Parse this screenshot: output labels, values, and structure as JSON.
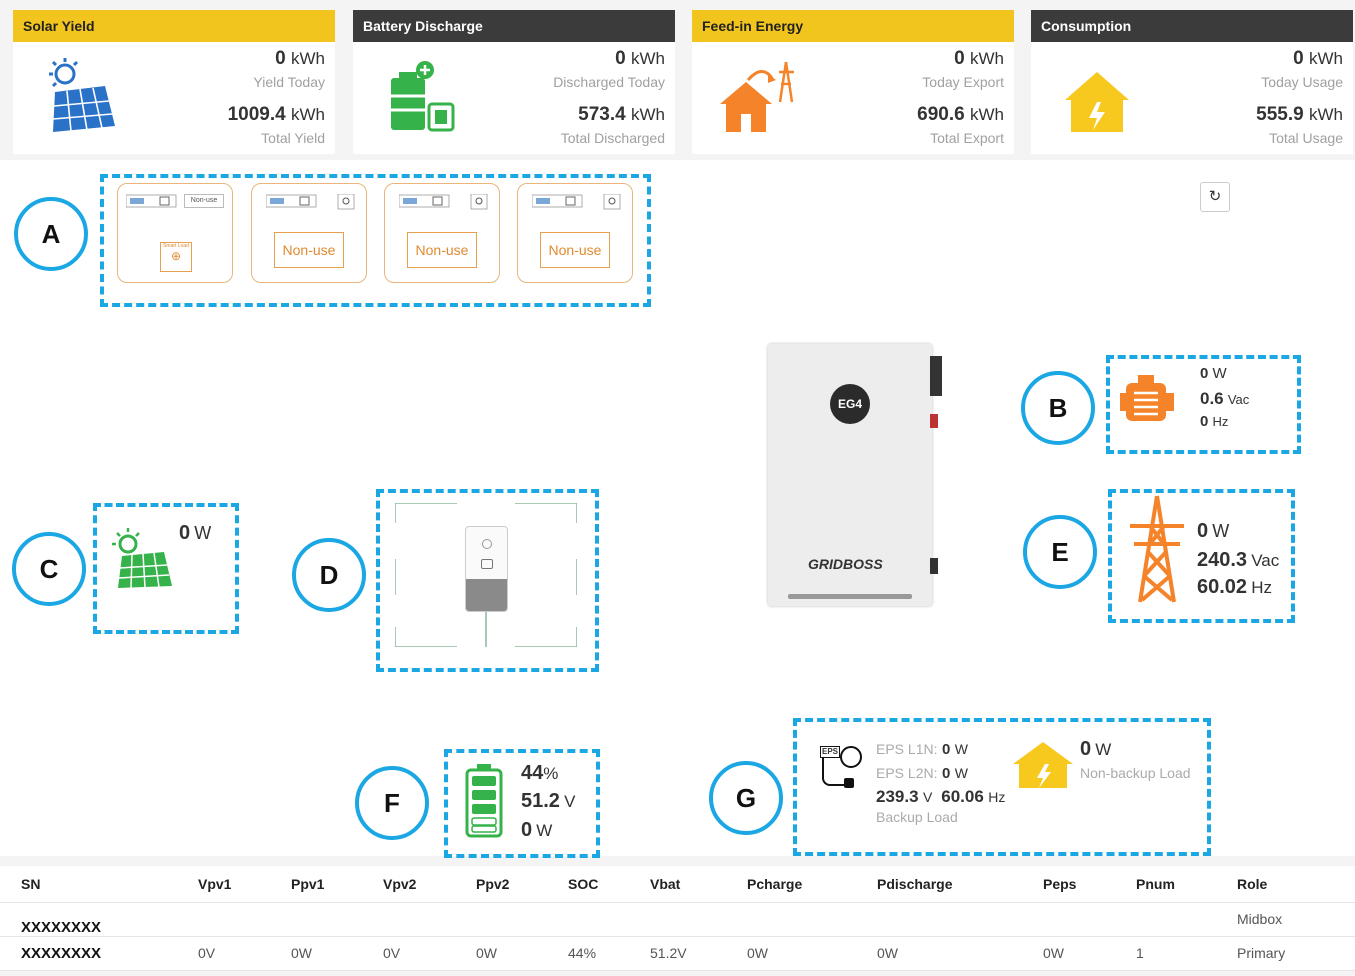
{
  "colors": {
    "accent_yellow": "#f2c51e",
    "dark_header": "#3b3b3b",
    "annotation_blue": "#1aa7e4",
    "solar_green": "#35b24a",
    "grid_orange": "#f5832a"
  },
  "cards": [
    {
      "title": "Solar Yield",
      "today_value": "0",
      "today_unit": "kWh",
      "today_label": "Yield Today",
      "total_value": "1009.4",
      "total_unit": "kWh",
      "total_label": "Total Yield",
      "icon": "solar-panel-icon"
    },
    {
      "title": "Battery Discharge",
      "today_value": "0",
      "today_unit": "kWh",
      "today_label": "Discharged Today",
      "total_value": "573.4",
      "total_unit": "kWh",
      "total_label": "Total Discharged",
      "icon": "battery-discharge-icon"
    },
    {
      "title": "Feed-in Energy",
      "today_value": "0",
      "today_unit": "kWh",
      "today_label": "Today Export",
      "total_value": "690.6",
      "total_unit": "kWh",
      "total_label": "Total Export",
      "icon": "house-export-icon"
    },
    {
      "title": "Consumption",
      "today_value": "0",
      "today_unit": "kWh",
      "today_label": "Today Usage",
      "total_value": "555.9",
      "total_unit": "kWh",
      "total_label": "Total Usage",
      "icon": "house-bolt-icon"
    }
  ],
  "callouts": {
    "a": "A",
    "b": "B",
    "c": "C",
    "d": "D",
    "e": "E",
    "f": "F",
    "g": "G"
  },
  "smart_ports": {
    "existing_label": "Existing Grid-tied System",
    "smart_load_label": "Smart Load",
    "non_use_small": "Non-use",
    "non_use": "Non-use"
  },
  "generator": {
    "power": "0",
    "power_unit": "W",
    "voltage": "0.6",
    "voltage_unit": "Vac",
    "freq": "0",
    "freq_unit": "Hz"
  },
  "pv": {
    "power": "0",
    "power_unit": "W"
  },
  "grid": {
    "power": "0",
    "power_unit": "W",
    "voltage": "240.3",
    "voltage_unit": "Vac",
    "freq": "60.02",
    "freq_unit": "Hz"
  },
  "device": {
    "logo": "EG4",
    "model": "GRIDBOSS"
  },
  "battery": {
    "soc": "44",
    "soc_unit": "%",
    "voltage": "51.2",
    "voltage_unit": "V",
    "power": "0",
    "power_unit": "W"
  },
  "eps": {
    "icon_label": "EPS",
    "l1n_label": "EPS L1N:",
    "l1n_value": "0",
    "l1n_unit": "W",
    "l2n_label": "EPS L2N:",
    "l2n_value": "0",
    "l2n_unit": "W",
    "voltage": "239.3",
    "voltage_unit": "V",
    "freq": "60.06",
    "freq_unit": "Hz",
    "backup_label": "Backup Load",
    "nonbackup_value": "0",
    "nonbackup_unit": "W",
    "nonbackup_label": "Non-backup Load"
  },
  "refresh_icon": "refresh-icon",
  "table": {
    "headers": [
      "SN",
      "Vpv1",
      "Ppv1",
      "Vpv2",
      "Ppv2",
      "SOC",
      "Vbat",
      "Pcharge",
      "Pdischarge",
      "Peps",
      "Pnum",
      "Role"
    ],
    "rows": [
      [
        "XXXXXXXX",
        "",
        "",
        "",
        "",
        "",
        "",
        "",
        "",
        "",
        "",
        "Midbox"
      ],
      [
        "XXXXXXXX",
        "0V",
        "0W",
        "0V",
        "0W",
        "44%",
        "51.2V",
        "0W",
        "0W",
        "0W",
        "1",
        "Primary"
      ]
    ]
  }
}
